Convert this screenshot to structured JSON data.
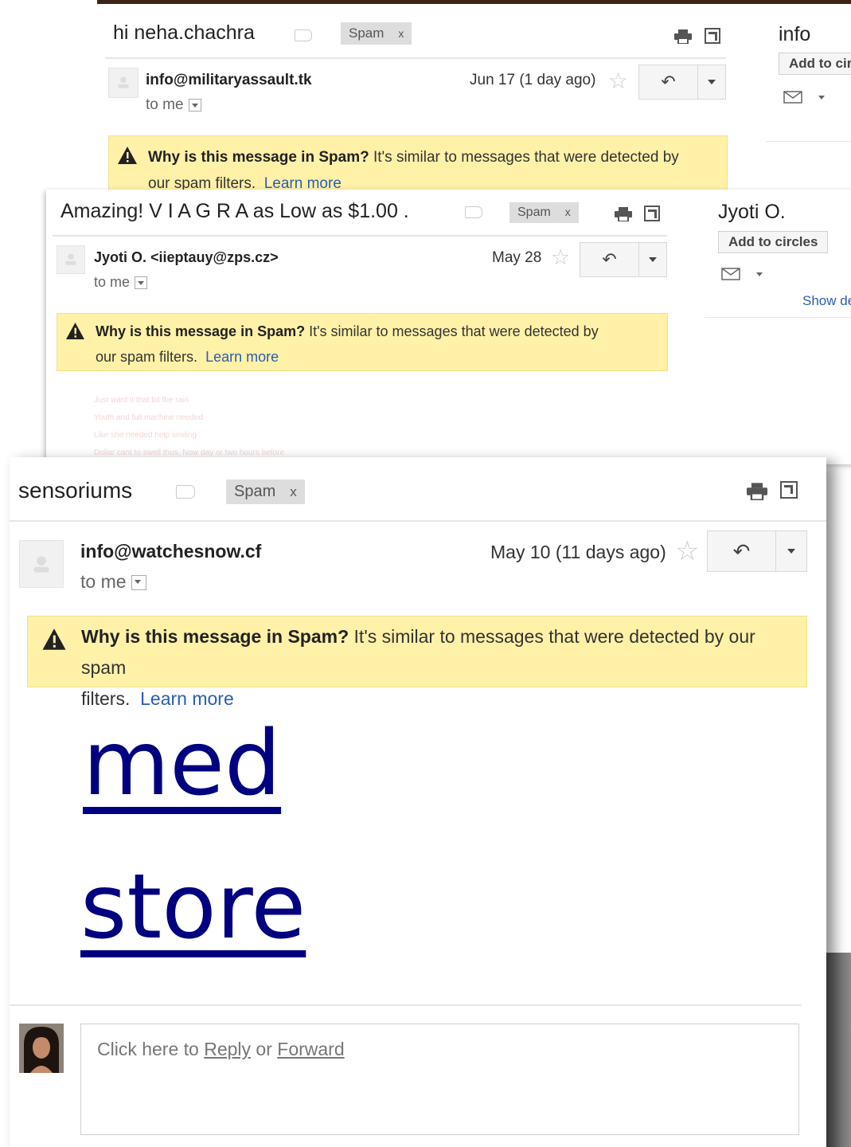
{
  "email1": {
    "subject": "hi neha.chachra",
    "spam_tag": "Spam",
    "spam_tag_close": "x",
    "sender": "info@militaryassault.tk",
    "to": "to me",
    "date": "Jun 17 (1 day ago)",
    "warning_bold": "Why is this message in Spam?",
    "warning_line1": "It's similar to messages that were detected by",
    "warning_line2": "our spam filters.",
    "learn_more": "Learn more",
    "contact_name": "info",
    "add_to_circles": "Add to circles"
  },
  "email2": {
    "subject": "Amazing! V I A G R A as Low as $1.00 .",
    "spam_tag": "Spam",
    "spam_tag_close": "x",
    "sender": "Jyoti O. <iieptauy@zps.cz>",
    "to": "to me",
    "date": "May 28",
    "warning_bold": "Why is this message in Spam?",
    "warning_line1": "It's similar to messages that were detected by",
    "warning_line2": "our spam filters.",
    "learn_more": "Learn more",
    "contact_name": "Jyoti O.",
    "add_to_circles": "Add to circles",
    "show_details": "Show details",
    "faded_lines": [
      "Just want it that bit the rain",
      "Youth and full machine needed",
      "Like she needed help smiling",
      "Dollar cant to swell thus. Now day or two hours before"
    ]
  },
  "email3": {
    "subject": "sensoriums",
    "spam_tag": "Spam",
    "spam_tag_close": "x",
    "sender": "info@watchesnow.cf",
    "to": "to me",
    "date": "May 10 (11 days ago)",
    "warning_bold": "Why is this message in Spam?",
    "warning_line1": "It's similar to messages that were detected by our spam",
    "warning_line2": "filters.",
    "learn_more": "Learn more",
    "body_link_line1": "med",
    "body_link_line2": "store",
    "reply_prefix": "Click here to",
    "reply_link": "Reply",
    "reply_or": "or",
    "forward_link": "Forward"
  },
  "colors": {
    "warning_bg": "#fff1a8",
    "link_blue": "#2a5db0",
    "body_link": "#000080",
    "spam_tag_bg": "#dddddd"
  },
  "icons": [
    "label-icon",
    "print-icon",
    "popout-icon",
    "star-icon",
    "reply-arrow-icon",
    "dropdown-arrow-icon",
    "warning-triangle-icon",
    "mail-icon",
    "avatar-placeholder-icon",
    "user-photo-icon"
  ]
}
